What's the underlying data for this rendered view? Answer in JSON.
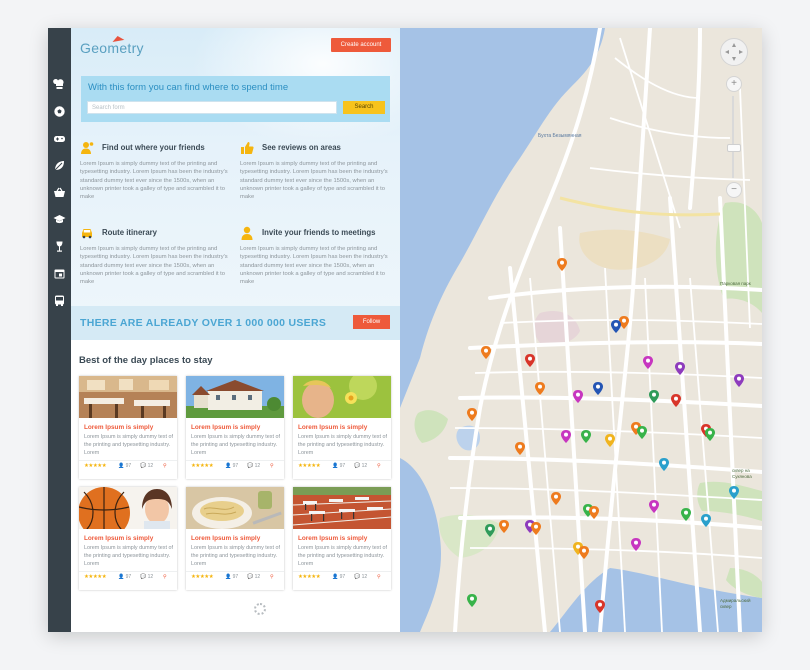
{
  "app": {
    "logo_text": "Geometry",
    "create_account_label": "Create account"
  },
  "sidebar": {
    "icons": [
      "chef-hat-icon",
      "soccer-ball-icon",
      "gamepad-icon",
      "leaf-icon",
      "basket-icon",
      "graduation-cap-icon",
      "wine-glass-icon",
      "calendar-icon",
      "bus-icon"
    ]
  },
  "search": {
    "title": "With this form you can find where to spend time",
    "placeholder": "Search form",
    "button_label": "Search"
  },
  "features": [
    {
      "title": "Find out where your friends",
      "text": "Lorem Ipsum is simply dummy text of the printing and typesetting industry. Lorem Ipsum has been the industry's standard dummy text ever since the 1500s, when an unknown printer took a galley of type and scrambled it to make"
    },
    {
      "title": "See reviews on areas",
      "text": "Lorem Ipsum is simply dummy text of the printing and typesetting industry. Lorem Ipsum has been the industry's standard dummy text ever since the 1500s, when an unknown printer took a galley of type and scrambled it to make"
    },
    {
      "title": "Route itinerary",
      "text": "Lorem Ipsum is simply dummy text of the printing and typesetting industry. Lorem Ipsum has been the industry's standard dummy text ever since the 1500s, when an unknown printer took a galley of type and scrambled it to make"
    },
    {
      "title": "Invite your friends to meetings",
      "text": "Lorem Ipsum is simply dummy text of the printing and typesetting industry. Lorem Ipsum has been the industry's standard dummy text ever since the 1500s, when an unknown printer took a galley of type and scrambled it to make"
    }
  ],
  "banner": {
    "text": "THERE ARE ALREADY OVER 1 000 000 USERS",
    "follow_label": "Follow"
  },
  "places": {
    "heading": "Best of the day places to stay",
    "cards": [
      {
        "title": "Lorem Ipsum is simply",
        "text": "Lorem Ipsum is simply dummy text of the printing and typesetting industry. Lorem",
        "rating": 5,
        "users": "97",
        "comments": "12",
        "image": "restaurant"
      },
      {
        "title": "Lorem Ipsum is simply",
        "text": "Lorem Ipsum is simply dummy text of the printing and typesetting industry. Lorem",
        "rating": 5,
        "users": "97",
        "comments": "12",
        "image": "castle"
      },
      {
        "title": "Lorem Ipsum is simply",
        "text": "Lorem Ipsum is simply dummy text of the printing and typesetting industry. Lorem",
        "rating": 5,
        "users": "97",
        "comments": "12",
        "image": "flower"
      },
      {
        "title": "Lorem Ipsum is simply",
        "text": "Lorem Ipsum is simply dummy text of the printing and typesetting industry. Lorem",
        "rating": 5,
        "users": "97",
        "comments": "12",
        "image": "basketball"
      },
      {
        "title": "Lorem Ipsum is simply",
        "text": "Lorem Ipsum is simply dummy text of the printing and typesetting industry. Lorem",
        "rating": 5,
        "users": "97",
        "comments": "12",
        "image": "pasta"
      },
      {
        "title": "Lorem Ipsum is simply",
        "text": "Lorem Ipsum is simply dummy text of the printing and typesetting industry. Lorem",
        "rating": 5,
        "users": "97",
        "comments": "12",
        "image": "track"
      }
    ]
  },
  "map": {
    "labels": {
      "bay": "Бухта Безымянная",
      "park1": "Парковая парк",
      "park2": "сквер на Сукянова",
      "admiral": "Адмиральский сквер"
    },
    "zoom_plus": "+",
    "zoom_minus": "−"
  },
  "colors": {
    "accent": "#ee5a3b",
    "search_bg": "#aadcf2",
    "search_btn": "#f7c31d",
    "rail": "#37424a",
    "water": "#a5c2e6",
    "park": "#c7e0b4"
  }
}
